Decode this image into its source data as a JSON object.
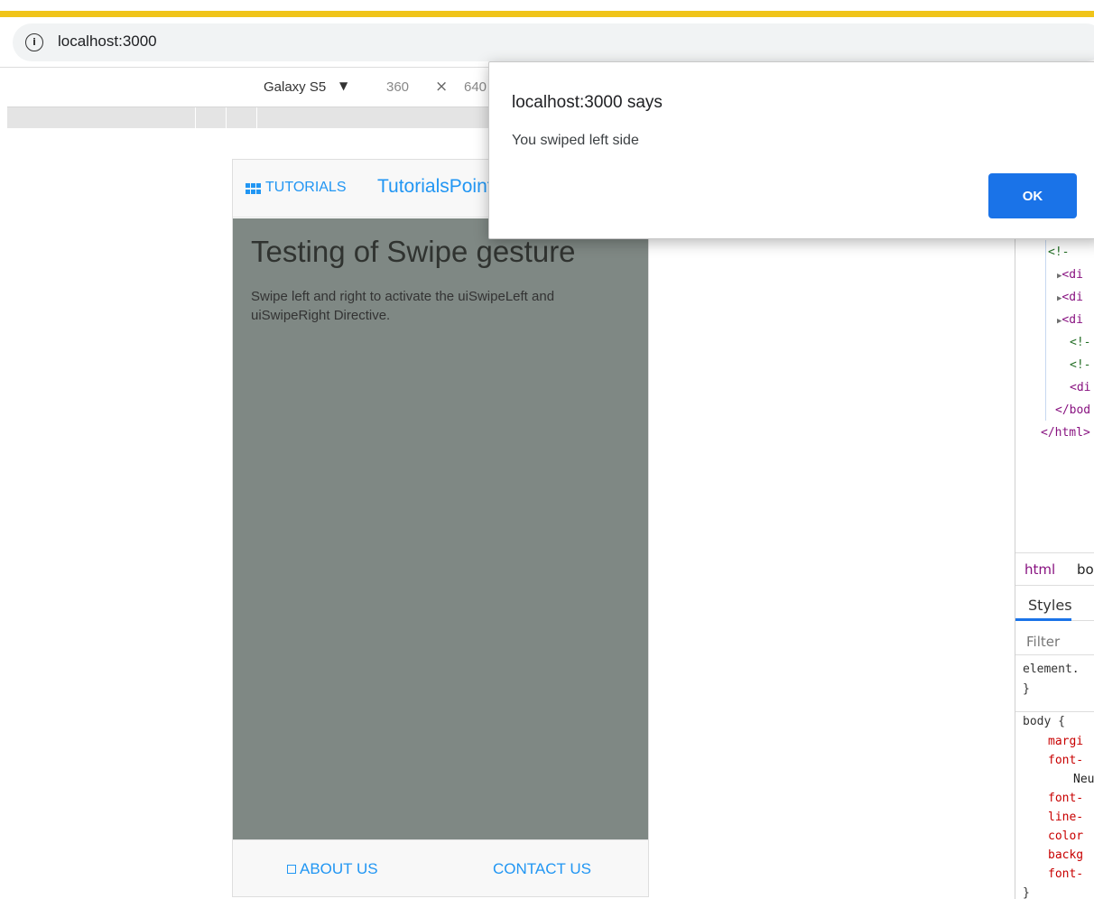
{
  "browser": {
    "url": "localhost:3000",
    "info_icon": "info-icon"
  },
  "device_toolbar": {
    "device": "Galaxy S5",
    "caret": "▼",
    "width": "360",
    "times": "×",
    "height": "640"
  },
  "app": {
    "nav": {
      "tutorials_label": "TUTORIALS",
      "brand": "TutorialsPoint"
    },
    "content": {
      "heading": "Testing of Swipe gesture",
      "description": "Swipe left and right to activate the uiSwipeLeft and uiSwipeRight Directive."
    },
    "footer": {
      "about_label": "ABOUT US",
      "contact_label": "CONTACT US"
    }
  },
  "devtools": {
    "code_lines": [
      "<!-",
      "<di",
      "<di",
      "<di",
      "<!-",
      "<!-",
      "<di",
      "</bod",
      "</html>"
    ],
    "breadcrumbs": [
      "html",
      "bo"
    ],
    "styles_tab": "Styles",
    "filter_placeholder": "Filter",
    "element_rule": [
      "element.",
      "}"
    ],
    "body_rule": {
      "selector": "body {",
      "lines": [
        "margi",
        "font-",
        "Neu",
        "font-",
        "line-",
        "color",
        "backg",
        "font-"
      ],
      "close": "}"
    }
  },
  "dialog": {
    "title": "localhost:3000 says",
    "message": "You swiped left side",
    "ok_label": "OK"
  },
  "colors": {
    "accent_bar": "#f0c419",
    "link_blue": "#2196f3",
    "content_bg": "#7f8884",
    "ok_button": "#1a73e8"
  }
}
